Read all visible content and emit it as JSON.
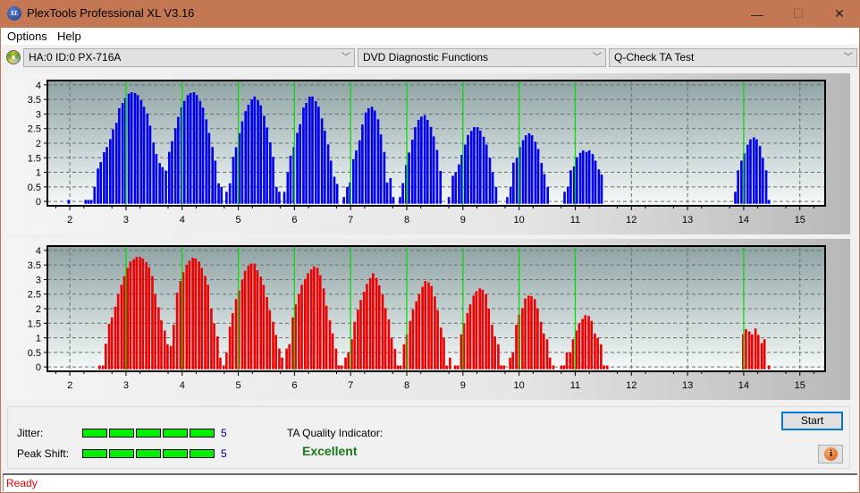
{
  "window": {
    "title": "PlexTools Professional XL V3.16",
    "app_icon_text": "XL",
    "controls": {
      "minimize": "—",
      "maximize": "☐",
      "close": "✕"
    }
  },
  "menu": [
    {
      "label": "Options"
    },
    {
      "label": "Help"
    }
  ],
  "toolbar": {
    "drive_select": "HA:0 ID:0  PX-716A",
    "function_select": "DVD Diagnostic Functions",
    "test_select": "Q-Check TA Test",
    "chevron": "﹀"
  },
  "chart_data": [
    {
      "type": "bar",
      "name": "ta-land-chart",
      "color": "#0000ee",
      "xlim": [
        1.6,
        15.45
      ],
      "ylim": [
        -0.15,
        4.15
      ],
      "xticks": [
        "2",
        "3",
        "4",
        "5",
        "6",
        "7",
        "8",
        "9",
        "10",
        "11",
        "12",
        "13",
        "14",
        "15"
      ],
      "yticks": [
        "0",
        "0.5",
        "1",
        "1.5",
        "2",
        "2.5",
        "3",
        "3.5",
        "4"
      ],
      "reference_lines": [
        3,
        4,
        5,
        6,
        7,
        8,
        9,
        10,
        11,
        14
      ],
      "grid": true,
      "bar_width_units": 0.042,
      "points": [
        [
          1.98,
          0.05
        ],
        [
          2.28,
          0.05
        ],
        [
          2.33,
          0.05
        ],
        [
          2.38,
          0.05
        ],
        [
          2.44,
          0.5
        ],
        [
          2.5,
          1.13
        ],
        [
          2.55,
          1.35
        ],
        [
          2.61,
          1.69
        ],
        [
          2.66,
          1.87
        ],
        [
          2.72,
          2.14
        ],
        [
          2.77,
          2.47
        ],
        [
          2.83,
          2.7
        ],
        [
          2.88,
          3.2
        ],
        [
          2.94,
          3.38
        ],
        [
          2.99,
          3.55
        ],
        [
          3.05,
          3.7
        ],
        [
          3.1,
          3.75
        ],
        [
          3.16,
          3.72
        ],
        [
          3.21,
          3.65
        ],
        [
          3.27,
          3.48
        ],
        [
          3.32,
          3.25
        ],
        [
          3.38,
          3.02
        ],
        [
          3.43,
          2.6
        ],
        [
          3.49,
          2.02
        ],
        [
          3.54,
          1.63
        ],
        [
          3.6,
          1.32
        ],
        [
          3.65,
          1.18
        ],
        [
          3.71,
          1.06
        ],
        [
          3.77,
          1.7
        ],
        [
          3.82,
          2.07
        ],
        [
          3.88,
          2.51
        ],
        [
          3.93,
          2.9
        ],
        [
          3.99,
          3.23
        ],
        [
          4.04,
          3.45
        ],
        [
          4.1,
          3.65
        ],
        [
          4.15,
          3.72
        ],
        [
          4.21,
          3.75
        ],
        [
          4.26,
          3.65
        ],
        [
          4.32,
          3.45
        ],
        [
          4.37,
          3.22
        ],
        [
          4.43,
          2.82
        ],
        [
          4.48,
          2.35
        ],
        [
          4.54,
          1.87
        ],
        [
          4.59,
          1.4
        ],
        [
          4.65,
          0.62
        ],
        [
          4.7,
          0.5
        ],
        [
          4.79,
          0.33
        ],
        [
          4.85,
          0.62
        ],
        [
          4.91,
          1.53
        ],
        [
          4.96,
          1.86
        ],
        [
          5.02,
          2.34
        ],
        [
          5.07,
          2.75
        ],
        [
          5.13,
          3.1
        ],
        [
          5.18,
          3.32
        ],
        [
          5.24,
          3.5
        ],
        [
          5.29,
          3.6
        ],
        [
          5.35,
          3.48
        ],
        [
          5.4,
          3.3
        ],
        [
          5.46,
          2.94
        ],
        [
          5.51,
          2.54
        ],
        [
          5.57,
          2.03
        ],
        [
          5.62,
          1.53
        ],
        [
          5.68,
          0.5
        ],
        [
          5.73,
          0.33
        ],
        [
          5.82,
          0.33
        ],
        [
          5.88,
          1.0
        ],
        [
          5.93,
          1.57
        ],
        [
          5.99,
          1.87
        ],
        [
          6.05,
          2.35
        ],
        [
          6.1,
          2.65
        ],
        [
          6.16,
          3.22
        ],
        [
          6.21,
          3.38
        ],
        [
          6.27,
          3.6
        ],
        [
          6.32,
          3.6
        ],
        [
          6.38,
          3.44
        ],
        [
          6.43,
          3.25
        ],
        [
          6.49,
          2.85
        ],
        [
          6.54,
          2.43
        ],
        [
          6.6,
          1.96
        ],
        [
          6.65,
          1.4
        ],
        [
          6.71,
          0.85
        ],
        [
          6.76,
          0.6
        ],
        [
          6.88,
          0.15
        ],
        [
          6.94,
          0.5
        ],
        [
          6.99,
          0.65
        ],
        [
          7.05,
          1.45
        ],
        [
          7.1,
          1.75
        ],
        [
          7.16,
          2.1
        ],
        [
          7.21,
          2.64
        ],
        [
          7.27,
          3.05
        ],
        [
          7.32,
          3.2
        ],
        [
          7.38,
          3.25
        ],
        [
          7.43,
          3.12
        ],
        [
          7.49,
          2.82
        ],
        [
          7.54,
          2.3
        ],
        [
          7.6,
          1.7
        ],
        [
          7.65,
          0.65
        ],
        [
          7.71,
          0.8
        ],
        [
          7.76,
          0.15
        ],
        [
          7.88,
          0.15
        ],
        [
          7.93,
          0.63
        ],
        [
          7.99,
          1.25
        ],
        [
          8.04,
          1.68
        ],
        [
          8.1,
          2.12
        ],
        [
          8.15,
          2.55
        ],
        [
          8.21,
          2.8
        ],
        [
          8.26,
          2.91
        ],
        [
          8.32,
          2.96
        ],
        [
          8.37,
          2.8
        ],
        [
          8.43,
          2.56
        ],
        [
          8.48,
          2.23
        ],
        [
          8.54,
          1.77
        ],
        [
          8.6,
          1.05
        ],
        [
          8.75,
          0.15
        ],
        [
          8.82,
          0.88
        ],
        [
          8.87,
          1.0
        ],
        [
          8.93,
          1.27
        ],
        [
          8.98,
          1.6
        ],
        [
          9.04,
          1.95
        ],
        [
          9.09,
          2.28
        ],
        [
          9.15,
          2.42
        ],
        [
          9.2,
          2.55
        ],
        [
          9.26,
          2.55
        ],
        [
          9.31,
          2.43
        ],
        [
          9.37,
          2.22
        ],
        [
          9.42,
          1.95
        ],
        [
          9.48,
          1.5
        ],
        [
          9.53,
          1.0
        ],
        [
          9.59,
          0.5
        ],
        [
          9.79,
          0.15
        ],
        [
          9.85,
          0.5
        ],
        [
          9.9,
          1.33
        ],
        [
          9.96,
          1.5
        ],
        [
          10.01,
          1.87
        ],
        [
          10.07,
          2.1
        ],
        [
          10.12,
          2.27
        ],
        [
          10.18,
          2.34
        ],
        [
          10.23,
          2.27
        ],
        [
          10.29,
          2.05
        ],
        [
          10.34,
          1.8
        ],
        [
          10.4,
          1.32
        ],
        [
          10.45,
          0.94
        ],
        [
          10.51,
          0.5
        ],
        [
          10.81,
          0.33
        ],
        [
          10.87,
          0.5
        ],
        [
          10.92,
          1.07
        ],
        [
          10.98,
          1.2
        ],
        [
          11.03,
          1.52
        ],
        [
          11.09,
          1.67
        ],
        [
          11.14,
          1.75
        ],
        [
          11.2,
          1.7
        ],
        [
          11.25,
          1.75
        ],
        [
          11.31,
          1.63
        ],
        [
          11.36,
          1.4
        ],
        [
          11.42,
          1.1
        ],
        [
          11.47,
          0.92
        ],
        [
          13.85,
          0.33
        ],
        [
          13.9,
          1.07
        ],
        [
          13.96,
          1.4
        ],
        [
          14.01,
          1.65
        ],
        [
          14.07,
          1.95
        ],
        [
          14.12,
          2.13
        ],
        [
          14.18,
          2.2
        ],
        [
          14.23,
          2.13
        ],
        [
          14.29,
          1.9
        ],
        [
          14.34,
          1.48
        ],
        [
          14.4,
          1.07
        ],
        [
          14.45,
          0.05
        ]
      ]
    },
    {
      "type": "bar",
      "name": "ta-pit-chart",
      "color": "#ee0000",
      "xlim": [
        1.6,
        15.45
      ],
      "ylim": [
        -0.15,
        4.15
      ],
      "xticks": [
        "2",
        "3",
        "4",
        "5",
        "6",
        "7",
        "8",
        "9",
        "10",
        "11",
        "12",
        "13",
        "14",
        "15"
      ],
      "yticks": [
        "0",
        "0.5",
        "1",
        "1.5",
        "2",
        "2.5",
        "3",
        "3.5",
        "4"
      ],
      "reference_lines": [
        3,
        4,
        5,
        6,
        7,
        8,
        9,
        10,
        11,
        14
      ],
      "grid": true,
      "bar_width_units": 0.042,
      "points": [
        [
          2.53,
          0.05
        ],
        [
          2.59,
          0.05
        ],
        [
          2.64,
          0.8
        ],
        [
          2.7,
          1.48
        ],
        [
          2.75,
          1.7
        ],
        [
          2.81,
          2.07
        ],
        [
          2.86,
          2.5
        ],
        [
          2.92,
          2.82
        ],
        [
          2.97,
          3.12
        ],
        [
          3.03,
          3.4
        ],
        [
          3.08,
          3.62
        ],
        [
          3.14,
          3.7
        ],
        [
          3.19,
          3.78
        ],
        [
          3.25,
          3.78
        ],
        [
          3.3,
          3.72
        ],
        [
          3.36,
          3.6
        ],
        [
          3.41,
          3.42
        ],
        [
          3.47,
          3.12
        ],
        [
          3.52,
          2.5
        ],
        [
          3.58,
          2.05
        ],
        [
          3.63,
          1.6
        ],
        [
          3.69,
          1.25
        ],
        [
          3.74,
          0.78
        ],
        [
          3.8,
          0.72
        ],
        [
          3.85,
          1.45
        ],
        [
          3.91,
          2.55
        ],
        [
          3.97,
          2.95
        ],
        [
          4.02,
          3.25
        ],
        [
          4.08,
          3.5
        ],
        [
          4.13,
          3.65
        ],
        [
          4.19,
          3.75
        ],
        [
          4.24,
          3.72
        ],
        [
          4.3,
          3.62
        ],
        [
          4.35,
          3.4
        ],
        [
          4.41,
          3.12
        ],
        [
          4.46,
          2.82
        ],
        [
          4.52,
          2.0
        ],
        [
          4.57,
          1.5
        ],
        [
          4.63,
          1.05
        ],
        [
          4.68,
          0.32
        ],
        [
          4.74,
          0.05
        ],
        [
          4.79,
          0.5
        ],
        [
          4.85,
          1.38
        ],
        [
          4.9,
          1.85
        ],
        [
          4.96,
          2.33
        ],
        [
          5.01,
          2.62
        ],
        [
          5.07,
          2.98
        ],
        [
          5.12,
          3.3
        ],
        [
          5.18,
          3.47
        ],
        [
          5.23,
          3.55
        ],
        [
          5.29,
          3.55
        ],
        [
          5.34,
          3.32
        ],
        [
          5.4,
          3.1
        ],
        [
          5.45,
          2.82
        ],
        [
          5.51,
          2.4
        ],
        [
          5.56,
          1.95
        ],
        [
          5.62,
          1.55
        ],
        [
          5.67,
          1.1
        ],
        [
          5.73,
          0.63
        ],
        [
          5.78,
          0.32
        ],
        [
          5.86,
          0.63
        ],
        [
          5.91,
          0.78
        ],
        [
          5.97,
          1.7
        ],
        [
          6.02,
          2.15
        ],
        [
          6.08,
          2.5
        ],
        [
          6.13,
          2.82
        ],
        [
          6.19,
          3.02
        ],
        [
          6.24,
          3.22
        ],
        [
          6.3,
          3.35
        ],
        [
          6.35,
          3.45
        ],
        [
          6.41,
          3.4
        ],
        [
          6.46,
          3.15
        ],
        [
          6.52,
          2.7
        ],
        [
          6.57,
          2.1
        ],
        [
          6.63,
          1.6
        ],
        [
          6.68,
          1.15
        ],
        [
          6.74,
          0.63
        ],
        [
          6.79,
          0.05
        ],
        [
          6.84,
          0.05
        ],
        [
          6.91,
          0.32
        ],
        [
          6.96,
          0.5
        ],
        [
          7.02,
          0.95
        ],
        [
          7.07,
          1.55
        ],
        [
          7.13,
          1.97
        ],
        [
          7.18,
          2.3
        ],
        [
          7.24,
          2.58
        ],
        [
          7.29,
          2.85
        ],
        [
          7.35,
          3.05
        ],
        [
          7.4,
          3.22
        ],
        [
          7.46,
          3.05
        ],
        [
          7.51,
          2.8
        ],
        [
          7.57,
          2.5
        ],
        [
          7.62,
          2.02
        ],
        [
          7.68,
          1.63
        ],
        [
          7.73,
          1.0
        ],
        [
          7.79,
          0.62
        ],
        [
          7.84,
          0.05
        ],
        [
          7.89,
          0.05
        ],
        [
          7.95,
          0.78
        ],
        [
          8.0,
          1.12
        ],
        [
          8.06,
          1.58
        ],
        [
          8.11,
          1.97
        ],
        [
          8.17,
          2.25
        ],
        [
          8.22,
          2.5
        ],
        [
          8.28,
          2.75
        ],
        [
          8.33,
          2.95
        ],
        [
          8.39,
          2.9
        ],
        [
          8.44,
          2.78
        ],
        [
          8.5,
          2.42
        ],
        [
          8.55,
          1.95
        ],
        [
          8.61,
          1.35
        ],
        [
          8.66,
          1.0
        ],
        [
          8.71,
          0.05
        ],
        [
          8.77,
          0.32
        ],
        [
          8.86,
          0.05
        ],
        [
          8.91,
          0.05
        ],
        [
          8.97,
          1.12
        ],
        [
          9.02,
          1.5
        ],
        [
          9.08,
          1.85
        ],
        [
          9.13,
          2.15
        ],
        [
          9.19,
          2.45
        ],
        [
          9.24,
          2.6
        ],
        [
          9.3,
          2.7
        ],
        [
          9.35,
          2.65
        ],
        [
          9.41,
          2.5
        ],
        [
          9.46,
          2.0
        ],
        [
          9.52,
          1.45
        ],
        [
          9.57,
          1.05
        ],
        [
          9.63,
          0.78
        ],
        [
          9.68,
          0.05
        ],
        [
          9.73,
          0.05
        ],
        [
          9.84,
          0.32
        ],
        [
          9.89,
          0.5
        ],
        [
          9.95,
          1.45
        ],
        [
          10.0,
          1.8
        ],
        [
          10.06,
          2.02
        ],
        [
          10.11,
          2.35
        ],
        [
          10.17,
          2.45
        ],
        [
          10.22,
          2.43
        ],
        [
          10.28,
          2.33
        ],
        [
          10.33,
          2.0
        ],
        [
          10.39,
          1.55
        ],
        [
          10.44,
          1.15
        ],
        [
          10.5,
          0.95
        ],
        [
          10.55,
          0.32
        ],
        [
          10.61,
          0.05
        ],
        [
          10.75,
          0.05
        ],
        [
          10.8,
          0.05
        ],
        [
          10.85,
          0.5
        ],
        [
          10.91,
          0.5
        ],
        [
          10.96,
          0.95
        ],
        [
          11.02,
          1.25
        ],
        [
          11.07,
          1.5
        ],
        [
          11.13,
          1.65
        ],
        [
          11.18,
          1.78
        ],
        [
          11.24,
          1.75
        ],
        [
          11.29,
          1.58
        ],
        [
          11.35,
          1.15
        ],
        [
          11.4,
          1.0
        ],
        [
          11.46,
          0.78
        ],
        [
          11.51,
          0.05
        ],
        [
          11.57,
          0.05
        ],
        [
          13.99,
          1.12
        ],
        [
          14.04,
          1.3
        ],
        [
          14.1,
          1.22
        ],
        [
          14.15,
          1.12
        ],
        [
          14.21,
          1.32
        ],
        [
          14.26,
          1.1
        ],
        [
          14.32,
          0.82
        ],
        [
          14.37,
          0.95
        ],
        [
          14.45,
          0.05
        ]
      ]
    }
  ],
  "bottom": {
    "jitter_label": "Jitter:",
    "jitter_value": "5",
    "jitter_level": 5,
    "peak_shift_label": "Peak Shift:",
    "peak_shift_value": "5",
    "peak_shift_level": 5,
    "meter_max": 5,
    "quality_label": "TA Quality Indicator:",
    "quality_value": "Excellent",
    "start_label": "Start",
    "info_glyph": "i"
  },
  "status": {
    "text": "Ready"
  }
}
